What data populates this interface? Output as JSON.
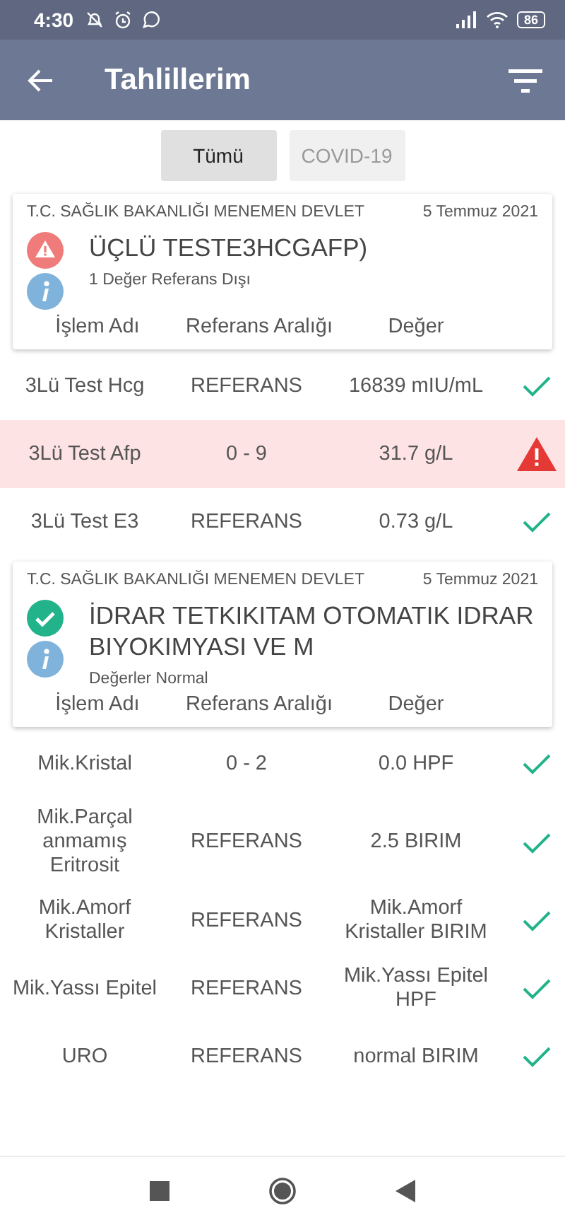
{
  "status_bar": {
    "time": "4:30",
    "battery": "86"
  },
  "app_bar": {
    "title": "Tahlillerim"
  },
  "tabs": [
    {
      "label": "Tümü",
      "selected": true
    },
    {
      "label": "COVID-19",
      "selected": false
    }
  ],
  "results": [
    {
      "institution": "T.C. SAĞLIK BAKANLIĞI MENEMEN DEVLET",
      "date": "5 Temmuz 2021",
      "kind": "alert",
      "title": "ÜÇLÜ TESTE3HCGAFP)",
      "summary": "1 Değer Referans Dışı",
      "columns": [
        "İşlem Adı",
        "Referans Aralığı",
        "Değer"
      ],
      "rows": [
        {
          "name": "3Lü Test Hcg",
          "reference": "REFERANS",
          "value": "16839 mIU/mL",
          "abnormal": false
        },
        {
          "name": "3Lü Test Afp",
          "reference": "0 - 9",
          "value": "31.7 g/L",
          "abnormal": true
        },
        {
          "name": "3Lü Test E3",
          "reference": "REFERANS",
          "value": "0.73 g/L",
          "abnormal": false
        }
      ]
    },
    {
      "institution": "T.C. SAĞLIK BAKANLIĞI MENEMEN DEVLET",
      "date": "5 Temmuz 2021",
      "kind": "ok",
      "title": "İDRAR TETKIKITAM OTOMATIK IDRAR BIYOKIMYASI VE M",
      "summary": "Değerler Normal",
      "columns": [
        "İşlem Adı",
        "Referans Aralığı",
        "Değer"
      ],
      "rows": [
        {
          "name": "Mik.Kristal",
          "reference": "0 - 2",
          "value": "0.0 HPF",
          "abnormal": false
        },
        {
          "name": "Mik.Parçal anmamış Eritrosit",
          "reference": "REFERANS",
          "value": "2.5 BIRIM",
          "abnormal": false
        },
        {
          "name": "Mik.Amorf Kristaller",
          "reference": "REFERANS",
          "value": "Mik.Amorf Kristaller BIRIM",
          "abnormal": false
        },
        {
          "name": "Mik.Yassı Epitel",
          "reference": "REFERANS",
          "value": "Mik.Yassı Epitel HPF",
          "abnormal": false
        },
        {
          "name": "URO",
          "reference": "REFERANS",
          "value": "normal BIRIM",
          "abnormal": false
        }
      ]
    }
  ]
}
